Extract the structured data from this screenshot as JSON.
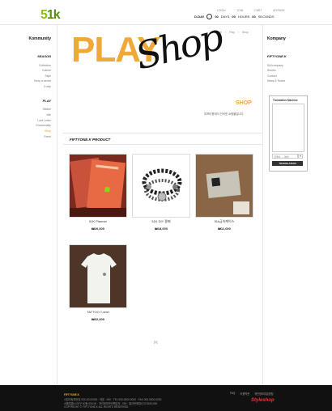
{
  "header": {
    "logo": {
      "main": "5",
      "accent": "1k"
    },
    "top_links": [
      "LOGIN",
      "JOIN",
      "CART",
      "MYPAGE"
    ],
    "dday": {
      "label": "D-DAY",
      "days": "00",
      "hours": "00",
      "minutes": "00",
      "days_unit": "DAYS",
      "hours_unit": "HOURS",
      "seconds": "SECONDS"
    }
  },
  "left_sidebar": {
    "title": "Kommunity",
    "season_title": "SEASON",
    "season_items": [
      "Collection",
      "Culture",
      "Style",
      "Keep a secret",
      "D-day"
    ],
    "play_title": "PLAY",
    "play_items": [
      "Sticker",
      "Idle",
      "Love Letter",
      "Knowhodaly",
      "Shop",
      "Event"
    ]
  },
  "right_sidebar": {
    "title": "Kompany",
    "section": "FIFTYONE.K",
    "items": [
      "51Kcompany",
      "Stories",
      "Contact",
      "News & Notice"
    ],
    "translation": {
      "title": "Translation Machine",
      "select": "한국어 → 영어",
      "button": "TRANSLATION"
    }
  },
  "main": {
    "breadcrumb": [
      "Home",
      "Play",
      "Shop"
    ],
    "banner": {
      "play": "PLAY",
      "shop": "Shop"
    },
    "section_title": "SHOP",
    "section_desc": "피프티원케이 인터넷 쇼핑몰입니다.",
    "category_label": "FIFTYONE.K PRODUCT",
    "products": [
      {
        "name": "51K Planner",
        "price": "₩20,000"
      },
      {
        "name": "51K DIY 팔찌",
        "price": "₩18,000"
      },
      {
        "name": "51k금속케이스",
        "price": "₩11,000"
      },
      {
        "name": "TATTOO T-shirt",
        "price": "₩32,000"
      }
    ],
    "pager": "[1]"
  },
  "footer": {
    "brand": "FIFTYONE.K",
    "lines": [
      "사업자등록번호 000-00-00000 · 대표 : 000 · TEL 000-0000-0000 · FAX 000-0000-0000",
      "서울특별시 00구 00동 000-00 · 개인정보관리책임자 : 000 · 통신판매업신고 0000-000",
      "COPYRIGHT © FIFTYONE.K ALL RIGHTS RESERVED."
    ],
    "links": [
      "FAQ",
      "이용약관",
      "개인정보취급방침"
    ],
    "badge": "Styleshop"
  },
  "colors": {
    "accent_orange": "#f0a838",
    "logo_green": "#8dbd1e",
    "footer_bg": "#111111"
  }
}
